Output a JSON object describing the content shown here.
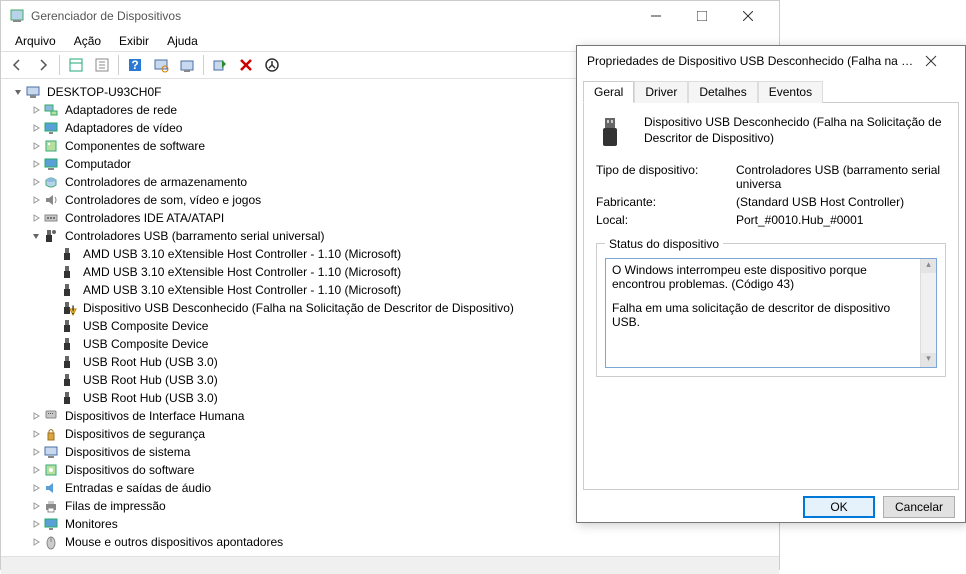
{
  "window": {
    "title": "Gerenciador de Dispositivos"
  },
  "menu": {
    "file": "Arquivo",
    "action": "Ação",
    "view": "Exibir",
    "help": "Ajuda"
  },
  "root": "DESKTOP-U93CH0F",
  "categories": {
    "network": "Adaptadores de rede",
    "video": "Adaptadores de vídeo",
    "software": "Componentes de software",
    "computer": "Computador",
    "storage": "Controladores de armazenamento",
    "sound": "Controladores de som, vídeo e jogos",
    "ide": "Controladores IDE ATA/ATAPI",
    "usb": "Controladores USB (barramento serial universal)",
    "hid": "Dispositivos de Interface Humana",
    "security": "Dispositivos de segurança",
    "system": "Dispositivos de sistema",
    "sw_devices": "Dispositivos do software",
    "audio_io": "Entradas e saídas de áudio",
    "print": "Filas de impressão",
    "monitors": "Monitores",
    "mouse": "Mouse e outros dispositivos apontadores"
  },
  "usb_children": [
    "AMD USB 3.10 eXtensible Host Controller - 1.10 (Microsoft)",
    "AMD USB 3.10 eXtensible Host Controller - 1.10 (Microsoft)",
    "AMD USB 3.10 eXtensible Host Controller - 1.10 (Microsoft)",
    "Dispositivo USB Desconhecido (Falha na Solicitação de Descritor de Dispositivo)",
    "USB Composite Device",
    "USB Composite Device",
    "USB Root Hub (USB 3.0)",
    "USB Root Hub (USB 3.0)",
    "USB Root Hub (USB 3.0)"
  ],
  "dialog": {
    "title": "Propriedades de Dispositivo USB Desconhecido (Falha na Solicitaç...",
    "tabs": {
      "general": "Geral",
      "driver": "Driver",
      "details": "Detalhes",
      "events": "Eventos"
    },
    "device_name": "Dispositivo USB Desconhecido (Falha na Solicitação de Descritor de Dispositivo)",
    "type_label": "Tipo de dispositivo:",
    "type_value": "Controladores USB (barramento serial universa",
    "mfr_label": "Fabricante:",
    "mfr_value": "(Standard USB Host Controller)",
    "loc_label": "Local:",
    "loc_value": "Port_#0010.Hub_#0001",
    "status_legend": "Status do dispositivo",
    "status_line1": "O Windows interrompeu este dispositivo porque encontrou problemas. (Código 43)",
    "status_line2": "Falha em uma solicitação de descritor de dispositivo USB.",
    "ok": "OK",
    "cancel": "Cancelar"
  }
}
